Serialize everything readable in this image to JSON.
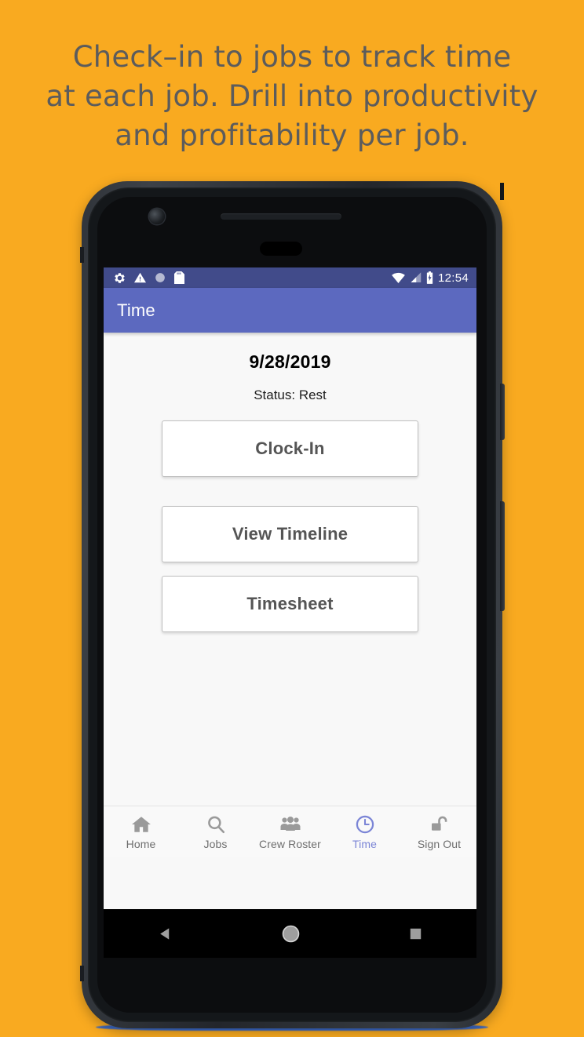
{
  "promo": {
    "lines": [
      "Check–in to jobs to track time",
      "at each job. Drill into productivity",
      "and profitability per job."
    ]
  },
  "colors": {
    "background_orange": "#F9AA20",
    "appbar_purple": "#5C69BF",
    "statusbar_purple": "#414B8A",
    "screen_background": "#F8F8F8",
    "active_nav": "#7B85D6",
    "button_text": "#555555",
    "nav_icon_gray": "#9A9A9A"
  },
  "phone": {
    "status_bar": {
      "left_icons": [
        "gear-icon",
        "warning-triangle-icon",
        "circle-icon",
        "sd-card-icon"
      ],
      "right_icons": [
        "wifi-icon",
        "cell-signal-icon",
        "battery-charging-icon"
      ],
      "clock": "12:54"
    },
    "app_bar": {
      "title": "Time"
    },
    "content": {
      "date": "9/28/2019",
      "status": "Status: Rest",
      "buttons": [
        {
          "label": "Clock-In",
          "name": "clock-in-button"
        },
        {
          "label": "View Timeline",
          "name": "view-timeline-button"
        },
        {
          "label": "Timesheet",
          "name": "timesheet-button"
        }
      ]
    },
    "bottom_nav": {
      "items": [
        {
          "label": "Home",
          "icon": "home-icon",
          "active": false
        },
        {
          "label": "Jobs",
          "icon": "search-icon",
          "active": false
        },
        {
          "label": "Crew Roster",
          "icon": "people-icon",
          "active": false
        },
        {
          "label": "Time",
          "icon": "clock-icon",
          "active": true
        },
        {
          "label": "Sign Out",
          "icon": "unlock-icon",
          "active": false
        }
      ]
    },
    "android_nav": {
      "buttons": [
        "back-triangle-icon",
        "home-circle-icon",
        "recents-square-icon"
      ]
    }
  }
}
